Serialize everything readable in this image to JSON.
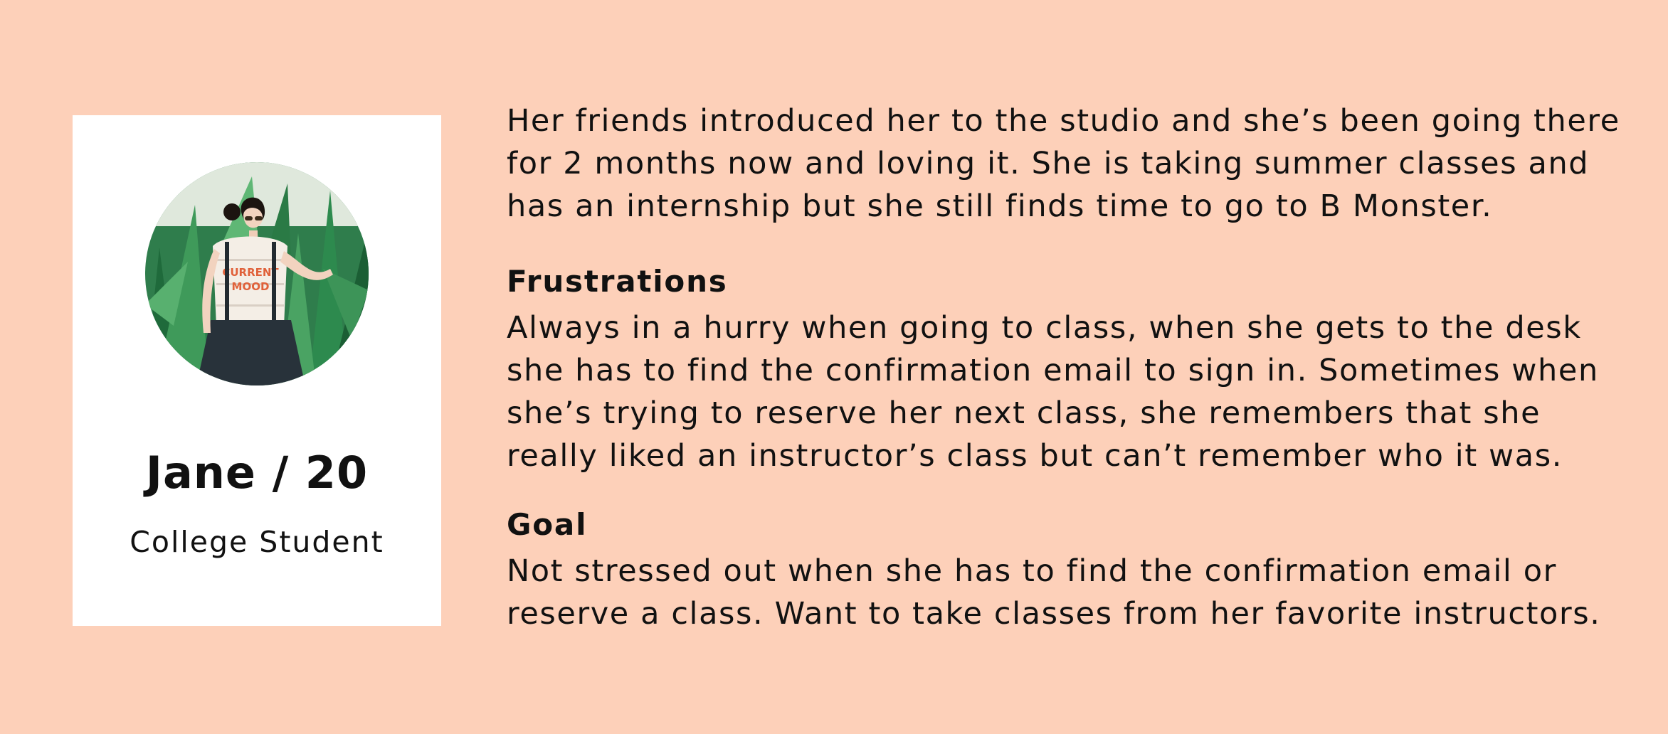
{
  "persona": {
    "name": "Jane / 20",
    "role": "College Student",
    "photo": "portrait-photo",
    "shirt_text_1": "CURRENT",
    "shirt_text_2": "MOOD"
  },
  "intro": {
    "lines": [
      "Her friends introduced her to the studio and she’s been going there",
      "for 2 months now and loving it. She is taking summer classes and",
      "has an internship but she still finds time to go to B Monster."
    ]
  },
  "frustrations": {
    "heading": "Frustrations",
    "lines": [
      "Always in a hurry when going to class, when she gets to the desk",
      "she has to find the confirmation email  to sign in. Sometimes when",
      "she’s trying to reserve her next class, she remembers that she",
      "really liked an instructor’s class but can’t remember who it was."
    ]
  },
  "goal": {
    "heading": "Goal",
    "lines": [
      "Not stressed out when she has to find the confirmation email or",
      "reserve a class. Want to take classes from her favorite instructors."
    ]
  },
  "colors": {
    "background": "#fdd0b9",
    "card": "#ffffff",
    "text": "#111111"
  }
}
